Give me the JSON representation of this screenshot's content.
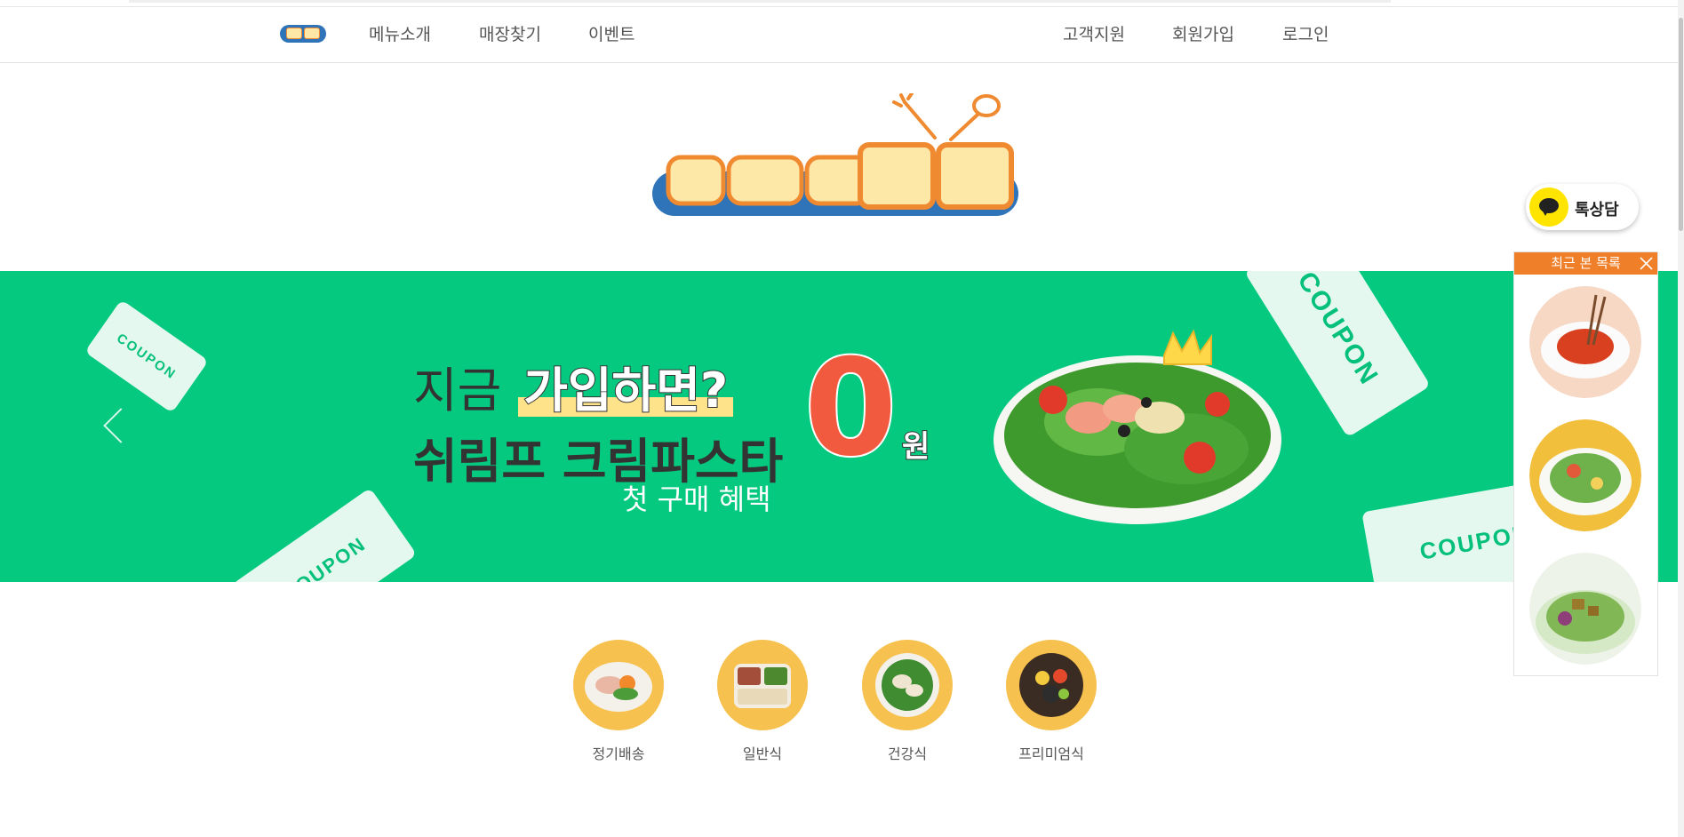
{
  "nav": {
    "left_links": [
      "메뉴소개",
      "매장찾기",
      "이벤트"
    ],
    "right_links": [
      "고객지원",
      "회원가입",
      "로그인"
    ]
  },
  "banner": {
    "line1_prefix": "지금",
    "line1_highlight": "가입하면?",
    "line2": "쉬림프 크림파스타",
    "price": "0",
    "unit": "원",
    "sub": "첫 구매 혜택",
    "coupon_text": "COUPON",
    "colors": {
      "background": "#04c97f",
      "price": "#f25a3f"
    }
  },
  "categories": [
    {
      "label": "정기배송"
    },
    {
      "label": "일반식"
    },
    {
      "label": "건강식"
    },
    {
      "label": "프리미엄식"
    }
  ],
  "side": {
    "talk_label": "톡상담",
    "recent_title": "최근 본 목록"
  },
  "colors": {
    "accent": "#f07f2a",
    "brand_blue": "#2f73b8",
    "category_bg": "#f6c14e"
  }
}
